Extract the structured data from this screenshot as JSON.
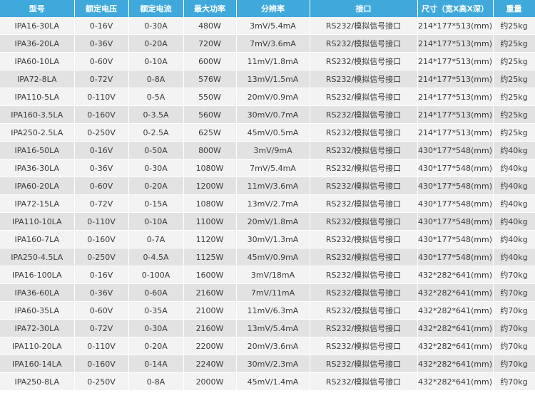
{
  "table": {
    "headers": [
      "型号",
      "额定电压",
      "额定电流",
      "最大功率",
      "分辨率",
      "接口",
      "尺寸（宽X高X深）",
      "重量"
    ],
    "rows": [
      [
        "IPA16-30LA",
        "0-16V",
        "0-30A",
        "480W",
        "3mV/5.4mA",
        "RS232/模拟信号接口",
        "214*177*513(mm)",
        "约25kg"
      ],
      [
        "IPA36-20LA",
        "0-36V",
        "0-20A",
        "720W",
        "7mV/3.6mA",
        "RS232/模拟信号接口",
        "214*177*513(mm)",
        "约25kg"
      ],
      [
        "IPA60-10LA",
        "0-60V",
        "0-10A",
        "600W",
        "11mV/1.8mA",
        "RS232/模拟信号接口",
        "214*177*513(mm)",
        "约25kg"
      ],
      [
        "IPA72-8LA",
        "0-72V",
        "0-8A",
        "576W",
        "13mV/1.5mA",
        "RS232/模拟信号接口",
        "214*177*513(mm)",
        "约25kg"
      ],
      [
        "IPA110-5LA",
        "0-110V",
        "0-5A",
        "550W",
        "20mV/0.9mA",
        "RS232/模拟信号接口",
        "214*177*513(mm)",
        "约25kg"
      ],
      [
        "IPA160-3.5LA",
        "0-160V",
        "0-3.5A",
        "560W",
        "30mV/0.7mA",
        "RS232/模拟信号接口",
        "214*177*513(mm)",
        "约25kg"
      ],
      [
        "IPA250-2.5LA",
        "0-250V",
        "0-2.5A",
        "625W",
        "45mV/0.5mA",
        "RS232/模拟信号接口",
        "214*177*513(mm)",
        "约25kg"
      ],
      [
        "IPA16-50LA",
        "0-16V",
        "0-50A",
        "800W",
        "3mV/9mA",
        "RS232/模拟信号接口",
        "430*177*548(mm)",
        "约40kg"
      ],
      [
        "IPA36-30LA",
        "0-36V",
        "0-30A",
        "1080W",
        "7mV/5.4mA",
        "RS232/模拟信号接口",
        "430*177*548(mm)",
        "约40kg"
      ],
      [
        "IPA60-20LA",
        "0-60V",
        "0-20A",
        "1200W",
        "11mV/3.6mA",
        "RS232/模拟信号接口",
        "430*177*548(mm)",
        "约40kg"
      ],
      [
        "IPA72-15LA",
        "0-72V",
        "0-15A",
        "1080W",
        "13mV/2.7mA",
        "RS232/模拟信号接口",
        "430*177*548(mm)",
        "约40kg"
      ],
      [
        "IPA110-10LA",
        "0-110V",
        "0-10A",
        "1100W",
        "20mV/1.8mA",
        "RS232/模拟信号接口",
        "430*177*548(mm)",
        "约40kg"
      ],
      [
        "IPA160-7LA",
        "0-160V",
        "0-7A",
        "1120W",
        "30mV/1.3mA",
        "RS232/模拟信号接口",
        "430*177*548(mm)",
        "约40kg"
      ],
      [
        "IPA250-4.5LA",
        "0-250V",
        "0-4.5A",
        "1125W",
        "45mV/0.9mA",
        "RS232/模拟信号接口",
        "430*177*548(mm)",
        "约40kg"
      ],
      [
        "IPA16-100LA",
        "0-16V",
        "0-100A",
        "1600W",
        "3mV/18mA",
        "RS232/模拟信号接口",
        "432*282*641(mm)",
        "约70kg"
      ],
      [
        "IPA36-60LA",
        "0-36V",
        "0-60A",
        "2160W",
        "7mV/11mA",
        "RS232/模拟信号接口",
        "432*282*641(mm)",
        "约70kg"
      ],
      [
        "IPA60-35LA",
        "0-60V",
        "0-35A",
        "2100W",
        "11mV/6.3mA",
        "RS232/模拟信号接口",
        "432*282*641(mm)",
        "约70kg"
      ],
      [
        "IPA72-30LA",
        "0-72V",
        "0-30A",
        "2160W",
        "13mV/5.4mA",
        "RS232/模拟信号接口",
        "432*282*641(mm)",
        "约70kg"
      ],
      [
        "IPA110-20LA",
        "0-110V",
        "0-20A",
        "2200W",
        "20mV/3.6mA",
        "RS232/模拟信号接口",
        "432*282*641(mm)",
        "约70kg"
      ],
      [
        "IPA160-14LA",
        "0-160V",
        "0-14A",
        "2240W",
        "30mV/2.3mA",
        "RS232/模拟信号接口",
        "432*282*641(mm)",
        "约70kg"
      ],
      [
        "IPA250-8LA",
        "0-250V",
        "0-8A",
        "2000W",
        "45mV/1.4mA",
        "RS232/模拟信号接口",
        "432*282*641(mm)",
        "约70kg"
      ]
    ]
  },
  "colors": {
    "header_bg": "#3fa9dc",
    "header_text": "#ffffff",
    "row_light": "#f3f3f3",
    "row_dark": "#e2e2e2",
    "cell_text": "#3a3a3a"
  }
}
